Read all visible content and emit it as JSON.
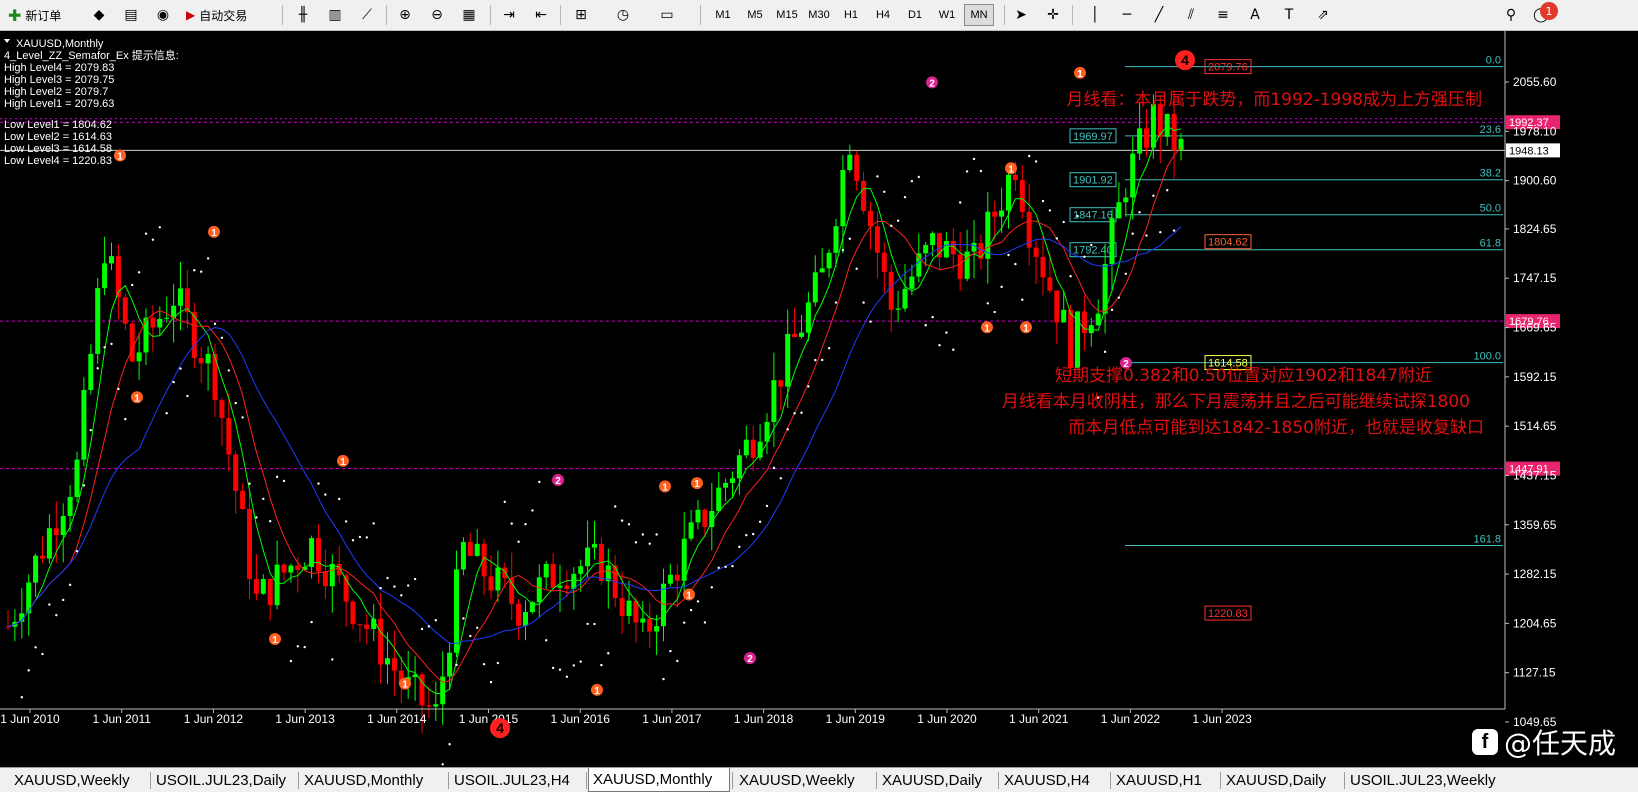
{
  "toolbar": {
    "new_order": "新订单",
    "auto_trading": "自动交易",
    "timeframes": [
      "M1",
      "M5",
      "M15",
      "M30",
      "H1",
      "H4",
      "D1",
      "W1",
      "MN"
    ],
    "active_timeframe": "MN",
    "notification_count": "1"
  },
  "chart": {
    "symbol_line": "XAUUSD,Monthly",
    "indicator_title": "4_Level_ZZ_Semafor_Ex 提示信息:",
    "high_levels": [
      "High Level4 = 2079.83",
      "High Level3 = 2079.75",
      "High Level2 = 2079.7",
      "High Level1 = 2079.63"
    ],
    "low_levels": [
      "Low Level1 = 1804.62",
      "Low Level2 = 1614.63",
      "Low Level3 = 1614.58",
      "Low Level4 = 1220.83"
    ],
    "price_axis": [
      "2055.60",
      "1978.10",
      "1900.60",
      "1824.65",
      "1747.15",
      "1669.65",
      "1592.15",
      "1514.65",
      "1437.15",
      "1359.65",
      "1282.15",
      "1204.65",
      "1127.15",
      "1049.65"
    ],
    "time_axis": [
      "1 Jun 2010",
      "1 Jun 2011",
      "1 Jun 2012",
      "1 Jun 2013",
      "1 Jun 2014",
      "1 Jun 2015",
      "1 Jun 2016",
      "1 Jun 2017",
      "1 Jun 2018",
      "1 Jun 2019",
      "1 Jun 2020",
      "1 Jun 2021",
      "1 Jun 2022",
      "1 Jun 2023"
    ],
    "price_tags": {
      "current": "1948.13",
      "h1": "1992.37",
      "h2": "1679.76",
      "h3": "1447.91"
    },
    "fib_labels": [
      "0.0",
      "23.6",
      "38.2",
      "50.0",
      "61.8",
      "100.0",
      "161.8"
    ],
    "box_labels": [
      "2079.76",
      "1969.97",
      "1901.92",
      "1847.16",
      "1792.40",
      "1804.62",
      "1614.58",
      "1220.83"
    ],
    "annotations": [
      "月线看：本月属于跌势，而1992-1998成为上方强压制",
      "短期支撑0.382和0.50位置对应1902和1847附近",
      "月线看本月收阴柱，那么下月震荡并且之后可能继续试探1800",
      "而本月低点可能到达1842-1850附近，也就是收复缺口"
    ],
    "semafor_marks": [
      "1",
      "2",
      "4"
    ],
    "colors": {
      "bull": "#00ff00",
      "bear": "#ff0000",
      "ma_fast": "#00ff00",
      "ma_mid": "#ff2020",
      "ma_slow": "#1e3cff",
      "fib": "#40c0c0",
      "level": "#cc00cc",
      "text": "#e01010"
    }
  },
  "watermark": "@任天成",
  "tabs": [
    "XAUUSD,Weekly",
    "USOIL.JUL23,Daily",
    "XAUUSD,Monthly",
    "USOIL.JUL23,H4",
    "XAUUSD,Monthly",
    "XAUUSD,Weekly",
    "XAUUSD,Daily",
    "XAUUSD,H4",
    "XAUUSD,H1",
    "XAUUSD,Daily",
    "USOIL.JUL23,Weekly"
  ],
  "active_tab_index": 4
}
